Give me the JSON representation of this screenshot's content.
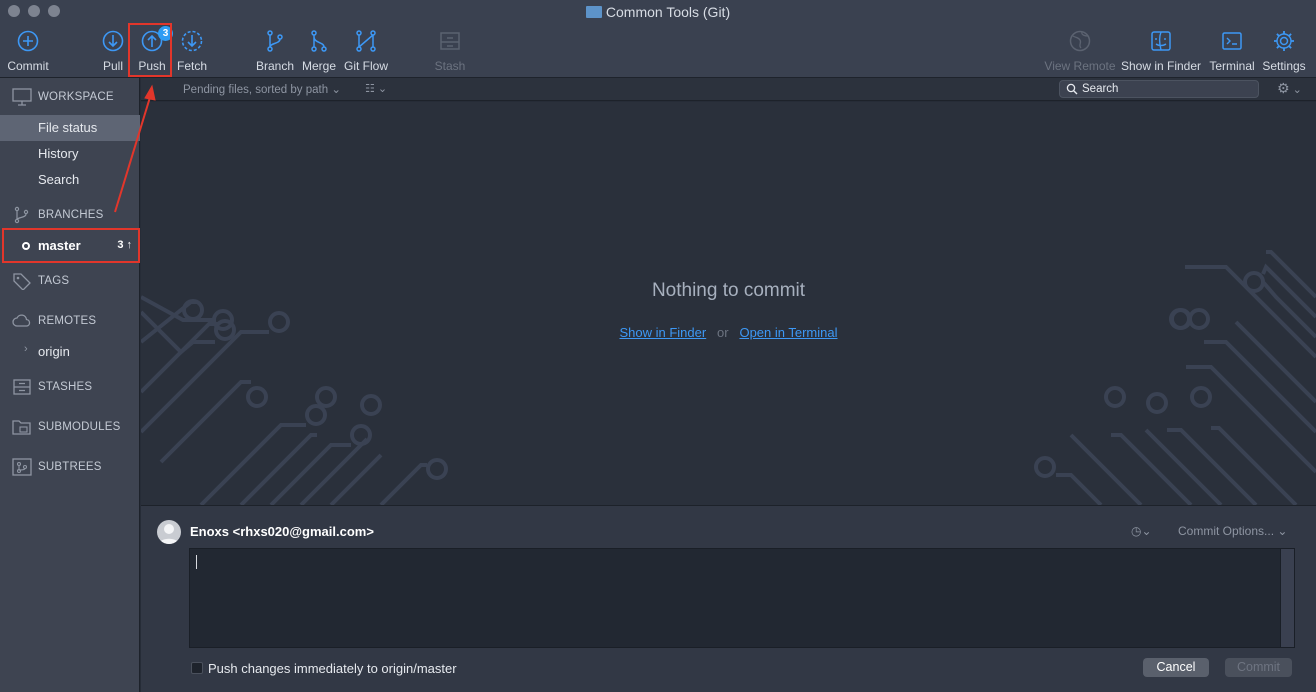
{
  "window": {
    "title": "Common Tools (Git)"
  },
  "toolbar": {
    "commit": "Commit",
    "pull": "Pull",
    "push": "Push",
    "push_badge": "3",
    "fetch": "Fetch",
    "branch": "Branch",
    "merge": "Merge",
    "gitflow": "Git Flow",
    "stash": "Stash",
    "view_remote": "View Remote",
    "show_in_finder": "Show in Finder",
    "terminal": "Terminal",
    "settings": "Settings"
  },
  "sidebar": {
    "workspace": "WORKSPACE",
    "workspace_items": [
      "File status",
      "History",
      "Search"
    ],
    "branches": "BRANCHES",
    "branch_name": "master",
    "branch_ahead": "3",
    "tags": "TAGS",
    "remotes": "REMOTES",
    "remote_name": "origin",
    "stashes": "STASHES",
    "submodules": "SUBMODULES",
    "subtrees": "SUBTREES"
  },
  "filterbar": {
    "pending": "Pending files, sorted by path",
    "search_placeholder": "Search"
  },
  "main": {
    "nothing": "Nothing to commit",
    "show_in_finder": "Show in Finder",
    "or": "or",
    "open_in_terminal": "Open in Terminal"
  },
  "commit": {
    "author": "Enoxs <rhxs020@gmail.com>",
    "commit_options": "Commit Options...",
    "push_immediately": "Push changes immediately to origin/master",
    "cancel": "Cancel",
    "commit": "Commit"
  },
  "colors": {
    "accent": "#3d98f5",
    "badge": "#2f9cf4",
    "annotation": "#e2362b"
  }
}
